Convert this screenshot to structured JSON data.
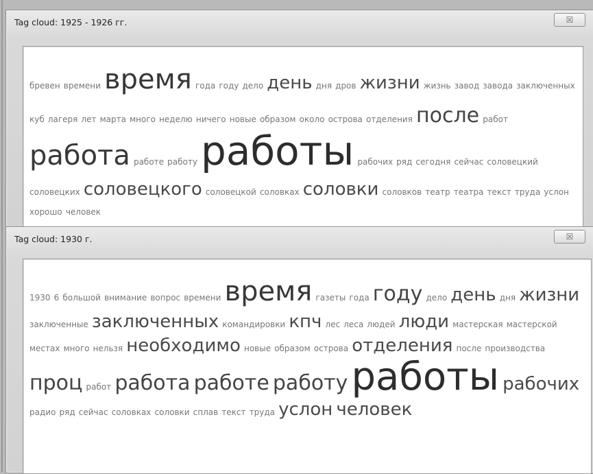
{
  "windows": [
    {
      "title": "Tag cloud: 1925 - 1926 гг.",
      "close_glyph": "☒",
      "tags": [
        {
          "text": "бревен",
          "size": 1
        },
        {
          "text": "времени",
          "size": 1
        },
        {
          "text": "время",
          "size": 5
        },
        {
          "text": "года",
          "size": 1
        },
        {
          "text": "году",
          "size": 1
        },
        {
          "text": "дело",
          "size": 1
        },
        {
          "text": "день",
          "size": 2
        },
        {
          "text": "дня",
          "size": 1
        },
        {
          "text": "дров",
          "size": 1
        },
        {
          "text": "жизни",
          "size": 2
        },
        {
          "text": "жизнь",
          "size": 1
        },
        {
          "text": "завод",
          "size": 1
        },
        {
          "text": "завода",
          "size": 1
        },
        {
          "text": "заключенных",
          "size": 1
        },
        {
          "text": "куб",
          "size": 1
        },
        {
          "text": "лагеря",
          "size": 1
        },
        {
          "text": "лет",
          "size": 1
        },
        {
          "text": "марта",
          "size": 1
        },
        {
          "text": "много",
          "size": 1
        },
        {
          "text": "неделю",
          "size": 1
        },
        {
          "text": "ничего",
          "size": 1
        },
        {
          "text": "новые",
          "size": 1
        },
        {
          "text": "образом",
          "size": 1
        },
        {
          "text": "около",
          "size": 1
        },
        {
          "text": "острова",
          "size": 1
        },
        {
          "text": "отделения",
          "size": 1
        },
        {
          "text": "после",
          "size": 3
        },
        {
          "text": "работ",
          "size": 1
        },
        {
          "text": "работа",
          "size": 4
        },
        {
          "text": "работе",
          "size": 1
        },
        {
          "text": "работу",
          "size": 1
        },
        {
          "text": "работы",
          "size": 6
        },
        {
          "text": "рабочих",
          "size": 1
        },
        {
          "text": "ряд",
          "size": 1
        },
        {
          "text": "сегодня",
          "size": 1
        },
        {
          "text": "сейчас",
          "size": 1
        },
        {
          "text": "соловецкий",
          "size": 1
        },
        {
          "text": "соловецких",
          "size": 1
        },
        {
          "text": "соловецкого",
          "size": 2
        },
        {
          "text": "соловецкой",
          "size": 1
        },
        {
          "text": "соловках",
          "size": 1
        },
        {
          "text": "соловки",
          "size": 2
        },
        {
          "text": "соловков",
          "size": 1
        },
        {
          "text": "театр",
          "size": 1
        },
        {
          "text": "театра",
          "size": 1
        },
        {
          "text": "текст",
          "size": 1
        },
        {
          "text": "труда",
          "size": 1
        },
        {
          "text": "услон",
          "size": 1
        },
        {
          "text": "хорошо",
          "size": 1
        },
        {
          "text": "человек",
          "size": 1
        }
      ]
    },
    {
      "title": "Tag cloud: 1930 г.",
      "close_glyph": "☒",
      "tags": [
        {
          "text": "1930",
          "size": 1
        },
        {
          "text": "6",
          "size": 1
        },
        {
          "text": "большой",
          "size": 1
        },
        {
          "text": "внимание",
          "size": 1
        },
        {
          "text": "вопрос",
          "size": 1
        },
        {
          "text": "времени",
          "size": 1
        },
        {
          "text": "время",
          "size": 4
        },
        {
          "text": "газеты",
          "size": 1
        },
        {
          "text": "года",
          "size": 1
        },
        {
          "text": "году",
          "size": 3
        },
        {
          "text": "дело",
          "size": 1
        },
        {
          "text": "день",
          "size": 2
        },
        {
          "text": "дня",
          "size": 1
        },
        {
          "text": "жизни",
          "size": 2
        },
        {
          "text": "заключенные",
          "size": 1
        },
        {
          "text": "заключенных",
          "size": 2
        },
        {
          "text": "командировки",
          "size": 1
        },
        {
          "text": "кпч",
          "size": 2
        },
        {
          "text": "лес",
          "size": 1
        },
        {
          "text": "леса",
          "size": 1
        },
        {
          "text": "людей",
          "size": 1
        },
        {
          "text": "люди",
          "size": 2
        },
        {
          "text": "мастерская",
          "size": 1
        },
        {
          "text": "мастерской",
          "size": 1
        },
        {
          "text": "местах",
          "size": 1
        },
        {
          "text": "много",
          "size": 1
        },
        {
          "text": "нельзя",
          "size": 1
        },
        {
          "text": "необходимо",
          "size": 2
        },
        {
          "text": "новые",
          "size": 1
        },
        {
          "text": "образом",
          "size": 1
        },
        {
          "text": "острова",
          "size": 1
        },
        {
          "text": "отделения",
          "size": 2
        },
        {
          "text": "после",
          "size": 1
        },
        {
          "text": "производства",
          "size": 1
        },
        {
          "text": "проц",
          "size": 3
        },
        {
          "text": "работ",
          "size": 1
        },
        {
          "text": "работа",
          "size": 3
        },
        {
          "text": "работе",
          "size": 3
        },
        {
          "text": "работу",
          "size": 3
        },
        {
          "text": "работы",
          "size": 6
        },
        {
          "text": "рабочих",
          "size": 2
        },
        {
          "text": "радио",
          "size": 1
        },
        {
          "text": "ряд",
          "size": 1
        },
        {
          "text": "сейчас",
          "size": 1
        },
        {
          "text": "соловках",
          "size": 1
        },
        {
          "text": "соловки",
          "size": 1
        },
        {
          "text": "сплав",
          "size": 1
        },
        {
          "text": "текст",
          "size": 1
        },
        {
          "text": "труда",
          "size": 1
        },
        {
          "text": "услон",
          "size": 2
        },
        {
          "text": "человек",
          "size": 2
        }
      ]
    }
  ]
}
